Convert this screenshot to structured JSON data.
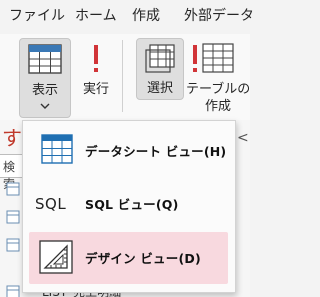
{
  "menubar": {
    "items": [
      {
        "label": "ファイル"
      },
      {
        "label": "ホーム"
      },
      {
        "label": "作成"
      },
      {
        "label": "外部データ"
      }
    ]
  },
  "ribbon": {
    "view_label": "表示",
    "run_label": "実行",
    "select_label": "選択",
    "table_label_line1": "テーブルの",
    "table_label_line2": "作成"
  },
  "dropdown": {
    "items": [
      {
        "label": "データシート ビュー(H)",
        "icon": "datasheet-grid-icon",
        "selected": false
      },
      {
        "label": "SQL ビュー(Q)",
        "icon_text": "SQL",
        "icon": "sql-icon",
        "selected": false
      },
      {
        "label": "デザイン ビュー(D)",
        "icon": "design-ruler-icon",
        "selected": true
      }
    ]
  },
  "background": {
    "title_char": "す",
    "search_text": "検索",
    "chevron": "<",
    "bottom_item": "LIST_売上明細"
  },
  "colors": {
    "accent_red": "#d13438",
    "selected_bg": "#f8d9df",
    "pressed_bg": "#dedede",
    "grid_blue": "#1f6fb2"
  }
}
